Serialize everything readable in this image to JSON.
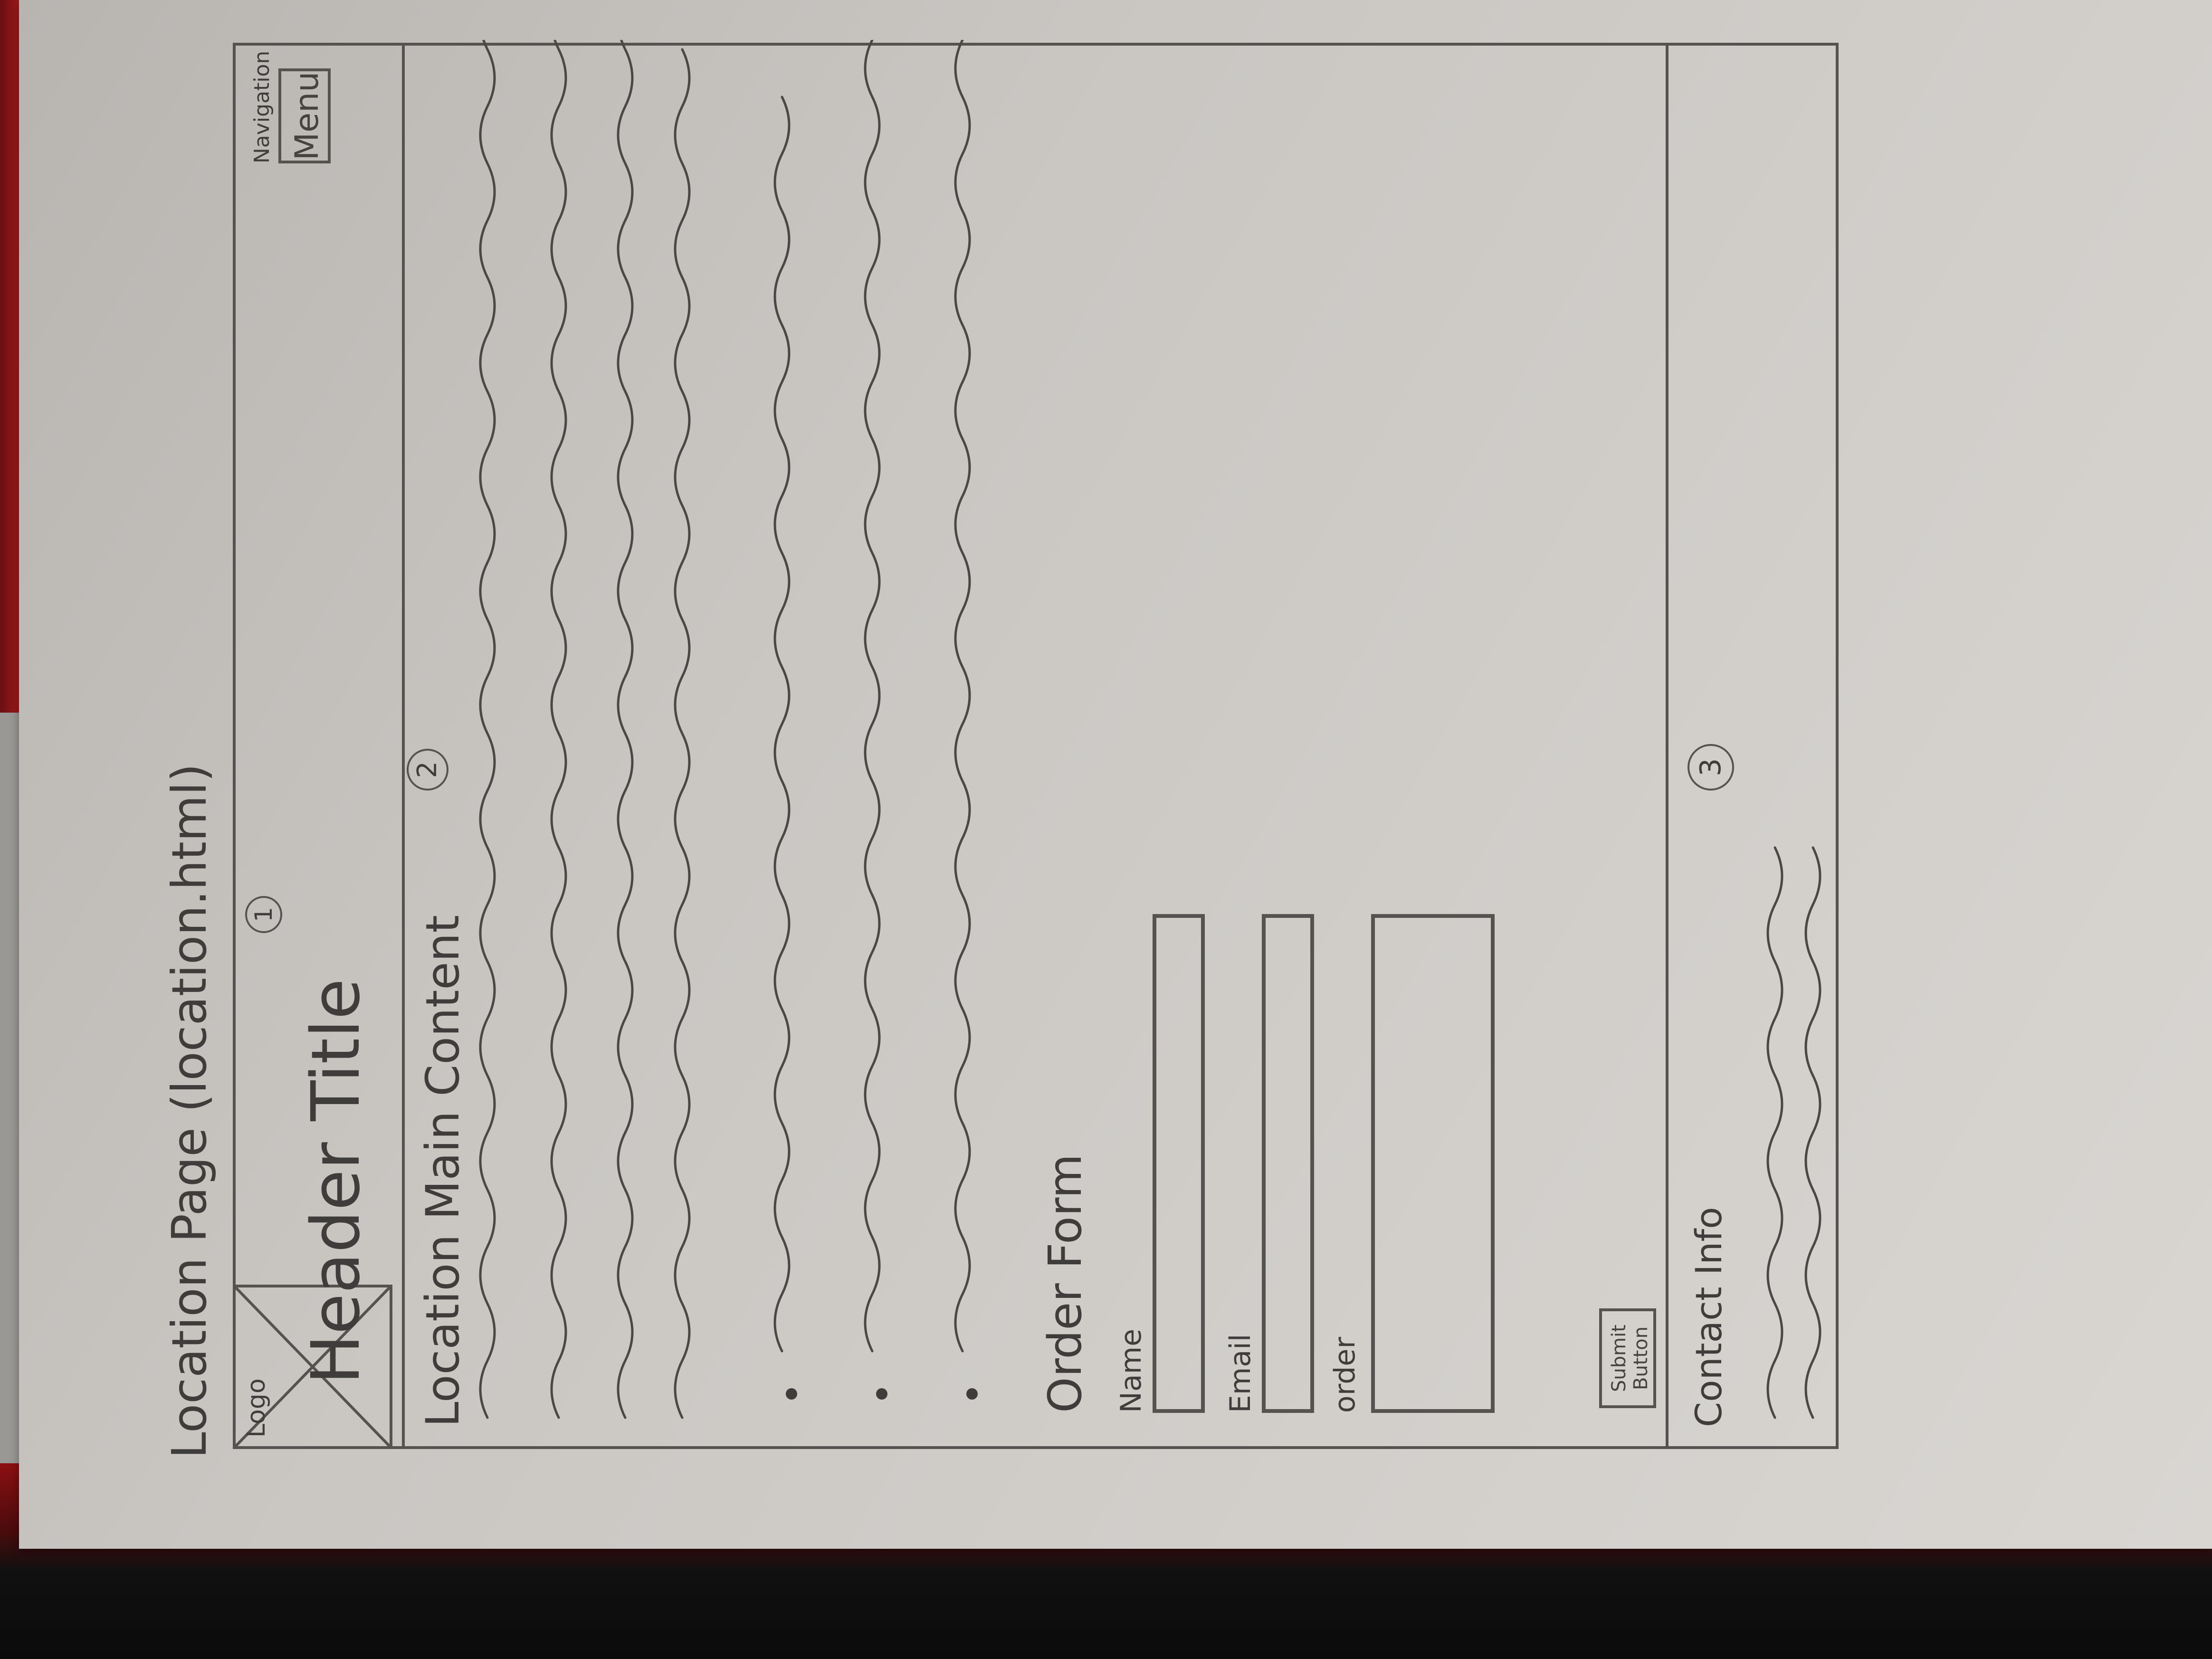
{
  "sketch": {
    "page_caption": "Location Page (location.html)",
    "header": {
      "logo_label": "Logo",
      "title": "Header Title",
      "marker": "1",
      "nav_caption": "Navigation",
      "menu_label": "Menu"
    },
    "main": {
      "title": "Location Main Content",
      "marker": "2"
    },
    "order_form": {
      "title": "Order Form",
      "name_label": "Name",
      "email_label": "Email",
      "order_label": "order",
      "submit_label": "Submit Button"
    },
    "footer": {
      "contact_label": "Contact Info",
      "marker": "3"
    }
  },
  "colors": {
    "paper": "#c9c6c2",
    "pencil": "#45423f",
    "background": "#9a9894"
  }
}
